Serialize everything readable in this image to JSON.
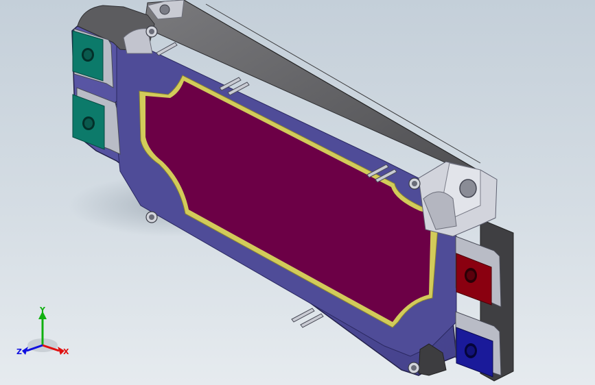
{
  "scene": {
    "title": "",
    "colors": {
      "background_top": "#c4cfd9",
      "background_bottom": "#e6ebef",
      "baseplate": "#4f4c98",
      "housing": "#5a5a5c",
      "cover_plate": "#6c0046",
      "gold_frame": "#d2cb5a",
      "terminal_green": "#0c7a6a",
      "terminal_red": "#8a0010",
      "terminal_blue": "#1a1a9a",
      "metal": "#b9bcc6"
    }
  },
  "triad": {
    "x_label": "X",
    "y_label": "Y",
    "z_label": "Z",
    "x_color": "#e01010",
    "y_color": "#10b010",
    "z_color": "#1010e0"
  }
}
